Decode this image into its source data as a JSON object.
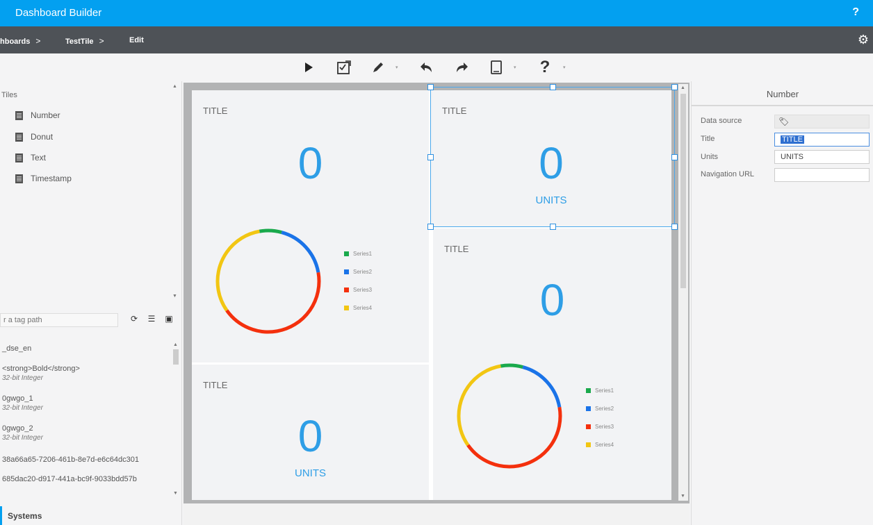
{
  "window": {
    "title": "Dashboard Builder",
    "help": "?"
  },
  "breadcrumbs": [
    {
      "label": "hboards",
      "sep": ">"
    },
    {
      "label": "TestTile",
      "sep": ">"
    },
    {
      "label": "Edit",
      "sep": ""
    }
  ],
  "settings_icon": "gear-icon",
  "toolbar": {
    "help_glyph": "?",
    "caret": "▾",
    "buttons": [
      "play-icon",
      "checklist-icon",
      "pencil-icon",
      "undo-icon",
      "redo-icon",
      "tablet-icon",
      "help-icon"
    ]
  },
  "left": {
    "tiles_heading": "Tiles",
    "tiles": [
      "Number",
      "Donut",
      "Text",
      "Timestamp"
    ],
    "tag_search_placeholder": "r a tag path",
    "tags": [
      {
        "name": "_dse_en",
        "type": ""
      },
      {
        "name": "<strong>Bold</strong>",
        "type": "32-bit Integer"
      },
      {
        "name": "0gwgo_1",
        "type": "32-bit Integer"
      },
      {
        "name": "0gwgo_2",
        "type": "32-bit Integer"
      },
      {
        "name": "38a66a65-7206-461b-8e7d-e6c64dc301",
        "type": ""
      },
      {
        "name": "685dac20-d917-441a-bc9f-9033bdd57b",
        "type": ""
      }
    ],
    "systems_tab": "Systems"
  },
  "canvas": {
    "tiles": [
      {
        "title": "TITLE",
        "value": "0",
        "units": ""
      },
      {
        "title": "TITLE",
        "value": "0",
        "units": "UNITS"
      },
      {
        "title": "TITLE",
        "value": "0",
        "units": ""
      },
      {
        "title": "TITLE",
        "value": "0",
        "units": "UNITS"
      }
    ],
    "legend": [
      "Series1",
      "Series2",
      "Series3",
      "Series4"
    ],
    "series_colors": [
      "#1aa94c",
      "#1a73e8",
      "#f4300d",
      "#f2c613"
    ],
    "donut_fractions": [
      0.07,
      0.18,
      0.43,
      0.32
    ]
  },
  "props": {
    "panel_title": "Number",
    "data_source_label": "Data source",
    "title_label": "Title",
    "title_value": "TITLE",
    "units_label": "Units",
    "units_value": "UNITS",
    "nav_url_label": "Navigation URL",
    "nav_url_value": ""
  }
}
